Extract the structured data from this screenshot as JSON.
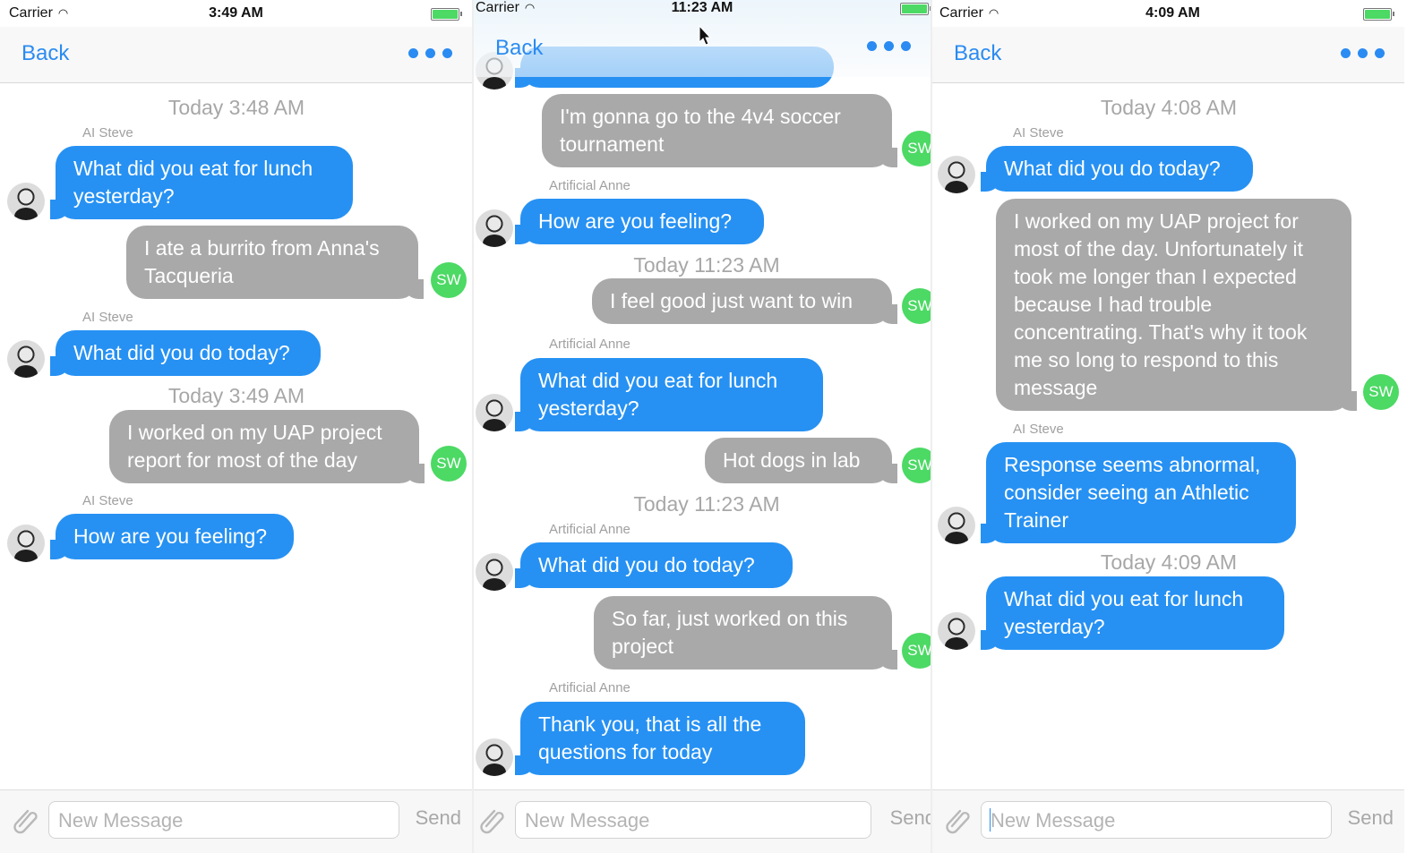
{
  "screens": [
    {
      "status": {
        "carrier": "Carrier",
        "time": "3:49 AM"
      },
      "nav": {
        "back": "Back"
      },
      "messages": [
        {
          "kind": "time",
          "text": "Today 3:48 AM"
        },
        {
          "kind": "sender",
          "text": "AI Steve"
        },
        {
          "kind": "in",
          "text": "What did you eat for lunch yesterday?"
        },
        {
          "kind": "out",
          "text": "I ate a burrito from Anna's Tacqueria"
        },
        {
          "kind": "sender",
          "text": "AI Steve"
        },
        {
          "kind": "in",
          "text": "What did you do today?"
        },
        {
          "kind": "time",
          "text": "Today 3:49 AM"
        },
        {
          "kind": "out",
          "text": "I worked on my UAP project report for most of the day"
        },
        {
          "kind": "sender",
          "text": "AI Steve"
        },
        {
          "kind": "in",
          "text": "How are you feeling?"
        }
      ],
      "input": {
        "placeholder": "New Message",
        "send": "Send"
      }
    },
    {
      "status": {
        "carrier": "Carrier",
        "time": "11:23 AM"
      },
      "nav": {
        "back": "Back"
      },
      "messages": [
        {
          "kind": "out",
          "text": "I'm gonna go to the 4v4 soccer tournament"
        },
        {
          "kind": "sender",
          "text": "Artificial Anne"
        },
        {
          "kind": "in",
          "text": "How are you feeling?"
        },
        {
          "kind": "time",
          "text": "Today 11:23 AM"
        },
        {
          "kind": "out",
          "text": "I feel good just want to win"
        },
        {
          "kind": "sender",
          "text": "Artificial Anne"
        },
        {
          "kind": "in",
          "text": "What did you eat for lunch yesterday?"
        },
        {
          "kind": "out",
          "text": "Hot dogs in lab"
        },
        {
          "kind": "time",
          "text": "Today 11:23 AM"
        },
        {
          "kind": "sender",
          "text": "Artificial Anne"
        },
        {
          "kind": "in",
          "text": "What did you do today?"
        },
        {
          "kind": "out",
          "text": "So far, just worked on this project"
        },
        {
          "kind": "sender",
          "text": "Artificial Anne"
        },
        {
          "kind": "in",
          "text": "Thank you, that is all the questions for today"
        }
      ],
      "input": {
        "placeholder": "New Message",
        "send": "Send"
      }
    },
    {
      "status": {
        "carrier": "Carrier",
        "time": "4:09 AM"
      },
      "nav": {
        "back": "Back"
      },
      "messages": [
        {
          "kind": "time",
          "text": "Today 4:08 AM"
        },
        {
          "kind": "sender",
          "text": "AI Steve"
        },
        {
          "kind": "in",
          "text": "What did you do today?"
        },
        {
          "kind": "out",
          "text": "I worked on my UAP project for most of the day. Unfortunately it took me longer than I expected because I had trouble concentrating. That's why it took me so long to respond to this message"
        },
        {
          "kind": "sender",
          "text": "AI Steve"
        },
        {
          "kind": "in",
          "text": "Response seems abnormal, consider seeing an Athletic Trainer"
        },
        {
          "kind": "time",
          "text": "Today 4:09 AM"
        },
        {
          "kind": "in",
          "text": "What did you eat for lunch yesterday?"
        }
      ],
      "input": {
        "placeholder": "New Message",
        "send": "Send"
      }
    }
  ],
  "user_initials": "SW",
  "colors": {
    "incoming": "#2691f3",
    "outgoing": "#a9a9a9",
    "accent": "#2a8bf2",
    "user_avatar": "#4cd964"
  },
  "icons": [
    "wifi-icon",
    "battery-icon",
    "more-dots-icon",
    "paperclip-icon",
    "avatar-photo",
    "mouse-cursor-icon"
  ]
}
